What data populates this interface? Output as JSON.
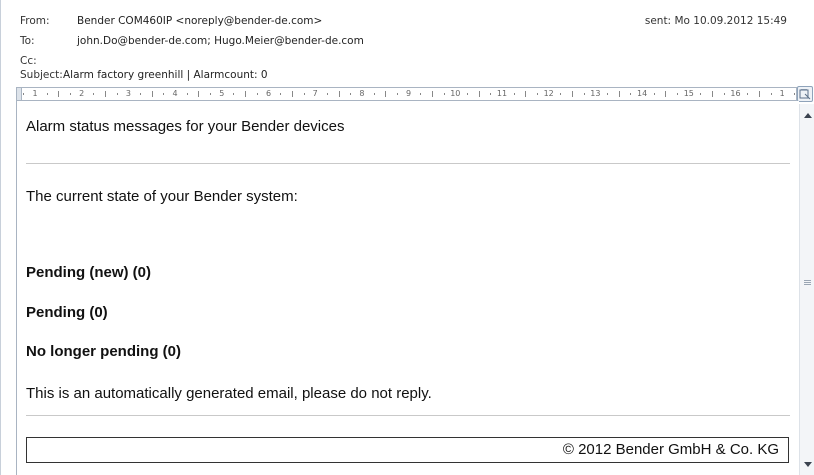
{
  "header": {
    "from_label": "From:",
    "from_value": "Bender COM460IP <noreply@bender-de.com>",
    "sent_label": "sent:",
    "sent_value": "Mo 10.09.2012 15:49",
    "to_label": "To:",
    "to_value": "john.Do@bender-de.com; Hugo.Meier@bender-de.com",
    "cc_label": "Cc:",
    "cc_value": "",
    "subject_label": "Subject:",
    "subject_value": "Alarm factory greenhill | Alarmcount: 0"
  },
  "ruler": {
    "numbers": [
      "1",
      "2",
      "3",
      "4",
      "5",
      "6",
      "7",
      "8",
      "9",
      "10",
      "11",
      "12",
      "13",
      "14",
      "15",
      "16",
      "1"
    ]
  },
  "body": {
    "heading": "Alarm status messages for your Bender devices",
    "state_text": "The current state of your Bender system:",
    "pending_new": "Pending (new) (0)",
    "pending": "Pending (0)",
    "no_longer_pending": "No longer pending (0)",
    "auto_note": "This is an automatically generated email, please do not reply.",
    "copyright": "© 2012 Bender GmbH & Co. KG"
  },
  "icons": {
    "ruler_toggle": "ruler-toggle-icon",
    "scroll_up": "arrow-up-icon",
    "scroll_down": "arrow-down-icon"
  },
  "colors": {
    "border": "#a9b4c2",
    "scrollbar_bg": "#f3f5f8"
  }
}
